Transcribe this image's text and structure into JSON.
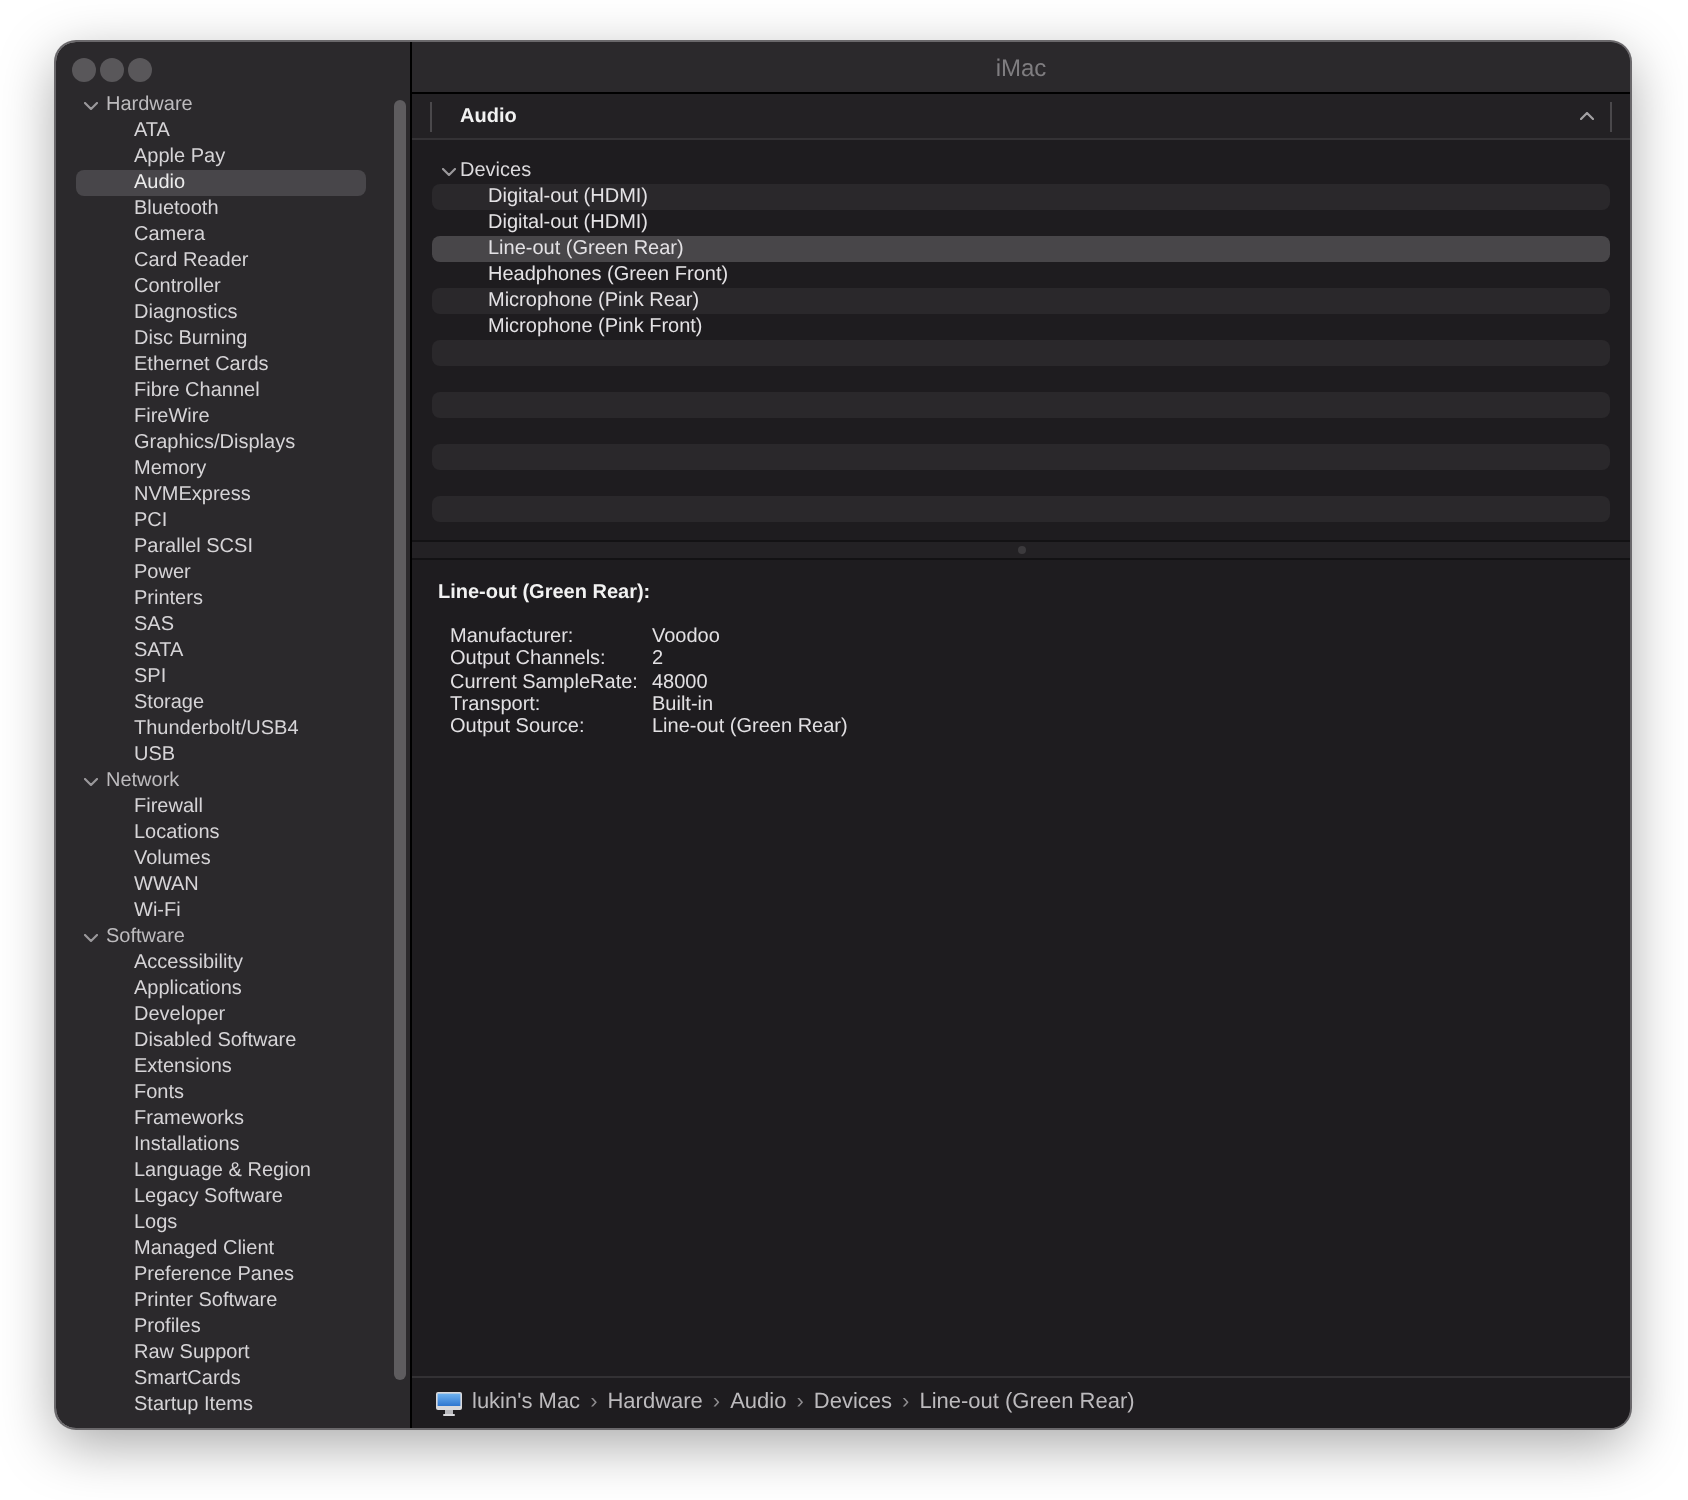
{
  "window": {
    "title": "iMac"
  },
  "sidebar": {
    "groups": [
      {
        "label": "Hardware",
        "expanded": true,
        "children": [
          {
            "label": "ATA",
            "selected": false
          },
          {
            "label": "Apple Pay",
            "selected": false
          },
          {
            "label": "Audio",
            "selected": true
          },
          {
            "label": "Bluetooth",
            "selected": false
          },
          {
            "label": "Camera",
            "selected": false
          },
          {
            "label": "Card Reader",
            "selected": false
          },
          {
            "label": "Controller",
            "selected": false
          },
          {
            "label": "Diagnostics",
            "selected": false
          },
          {
            "label": "Disc Burning",
            "selected": false
          },
          {
            "label": "Ethernet Cards",
            "selected": false
          },
          {
            "label": "Fibre Channel",
            "selected": false
          },
          {
            "label": "FireWire",
            "selected": false
          },
          {
            "label": "Graphics/Displays",
            "selected": false
          },
          {
            "label": "Memory",
            "selected": false
          },
          {
            "label": "NVMExpress",
            "selected": false
          },
          {
            "label": "PCI",
            "selected": false
          },
          {
            "label": "Parallel SCSI",
            "selected": false
          },
          {
            "label": "Power",
            "selected": false
          },
          {
            "label": "Printers",
            "selected": false
          },
          {
            "label": "SAS",
            "selected": false
          },
          {
            "label": "SATA",
            "selected": false
          },
          {
            "label": "SPI",
            "selected": false
          },
          {
            "label": "Storage",
            "selected": false
          },
          {
            "label": "Thunderbolt/USB4",
            "selected": false
          },
          {
            "label": "USB",
            "selected": false
          }
        ]
      },
      {
        "label": "Network",
        "expanded": true,
        "children": [
          {
            "label": "Firewall",
            "selected": false
          },
          {
            "label": "Locations",
            "selected": false
          },
          {
            "label": "Volumes",
            "selected": false
          },
          {
            "label": "WWAN",
            "selected": false
          },
          {
            "label": "Wi-Fi",
            "selected": false
          }
        ]
      },
      {
        "label": "Software",
        "expanded": true,
        "children": [
          {
            "label": "Accessibility",
            "selected": false
          },
          {
            "label": "Applications",
            "selected": false
          },
          {
            "label": "Developer",
            "selected": false
          },
          {
            "label": "Disabled Software",
            "selected": false
          },
          {
            "label": "Extensions",
            "selected": false
          },
          {
            "label": "Fonts",
            "selected": false
          },
          {
            "label": "Frameworks",
            "selected": false
          },
          {
            "label": "Installations",
            "selected": false
          },
          {
            "label": "Language & Region",
            "selected": false
          },
          {
            "label": "Legacy Software",
            "selected": false
          },
          {
            "label": "Logs",
            "selected": false
          },
          {
            "label": "Managed Client",
            "selected": false
          },
          {
            "label": "Preference Panes",
            "selected": false
          },
          {
            "label": "Printer Software",
            "selected": false
          },
          {
            "label": "Profiles",
            "selected": false
          },
          {
            "label": "Raw Support",
            "selected": false
          },
          {
            "label": "SmartCards",
            "selected": false
          },
          {
            "label": "Startup Items",
            "selected": false
          }
        ]
      }
    ]
  },
  "content": {
    "header": {
      "title": "Audio"
    },
    "tree": {
      "label": "Devices",
      "expanded": true,
      "children": [
        {
          "label": "Digital-out (HDMI)",
          "selected": false
        },
        {
          "label": "Digital-out (HDMI)",
          "selected": false
        },
        {
          "label": "Line-out (Green Rear)",
          "selected": true
        },
        {
          "label": "Headphones (Green Front)",
          "selected": false
        },
        {
          "label": "Microphone (Pink Rear)",
          "selected": false
        },
        {
          "label": "Microphone (Pink Front)",
          "selected": false
        }
      ]
    }
  },
  "detail": {
    "title": "Line-out (Green Rear):",
    "fields": [
      {
        "key": "Manufacturer:",
        "value": "Voodoo"
      },
      {
        "key": "Output Channels:",
        "value": "2"
      },
      {
        "key": "Current SampleRate:",
        "value": "48000"
      },
      {
        "key": "Transport:",
        "value": "Built-in"
      },
      {
        "key": "Output Source:",
        "value": "Line-out (Green Rear)"
      }
    ]
  },
  "path_bar": {
    "items": [
      {
        "label": "lukin's Mac"
      },
      {
        "separator": "›",
        "label": "Hardware"
      },
      {
        "separator": "›",
        "label": "Audio"
      },
      {
        "separator": "›",
        "label": "Devices"
      },
      {
        "separator": "›",
        "label": "Line-out (Green Rear)"
      }
    ]
  }
}
